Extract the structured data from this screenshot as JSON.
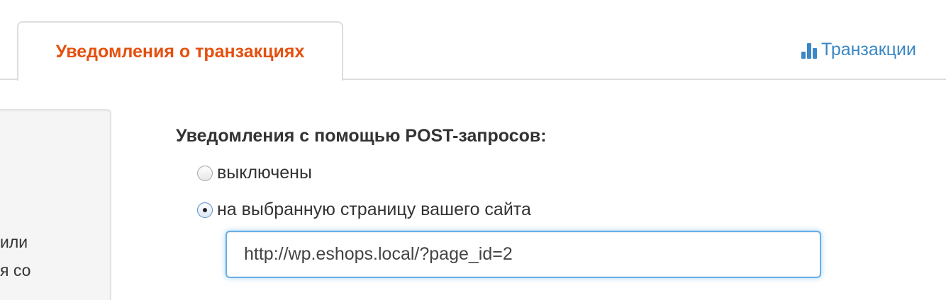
{
  "tabs": {
    "active_label": "Уведомления о транзакциях",
    "link_label": "Транзакции",
    "link_icon": "bar-chart-icon"
  },
  "sidebar": {
    "line1": "или",
    "line2": "я со"
  },
  "form": {
    "title": "Уведомления с помощью POST-запросов:",
    "options": [
      {
        "label": "выключены",
        "checked": false
      },
      {
        "label": "на выбранную страницу вашего сайта",
        "checked": true
      }
    ],
    "url_value": "http://wp.eshops.local/?page_id=2"
  },
  "colors": {
    "active_tab_text": "#e4500e",
    "link": "#3a87c4",
    "input_focus": "#66afe9"
  }
}
